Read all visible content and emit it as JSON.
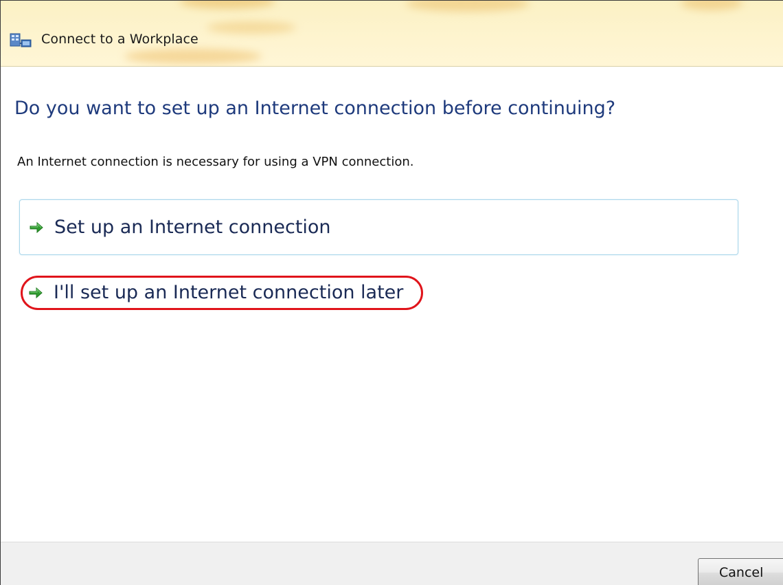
{
  "window": {
    "title": "Connect to a Workplace",
    "icon": "network-workplace-icon"
  },
  "main": {
    "heading": "Do you want to set up an Internet connection before continuing?",
    "description": "An Internet connection is necessary for using a VPN connection.",
    "options": [
      {
        "label": "Set up an Internet connection",
        "icon": "green-arrow-icon",
        "hovered": true
      },
      {
        "label": "I'll set up an Internet connection later",
        "icon": "green-arrow-icon",
        "highlighted": true
      }
    ]
  },
  "footer": {
    "cancel_label": "Cancel"
  },
  "colors": {
    "heading": "#1e3a7c",
    "option_text": "#1a2a55",
    "arrow": "#2f9a2f",
    "highlight_ring": "#e0141b",
    "titlebar": "#fdf3cc"
  }
}
